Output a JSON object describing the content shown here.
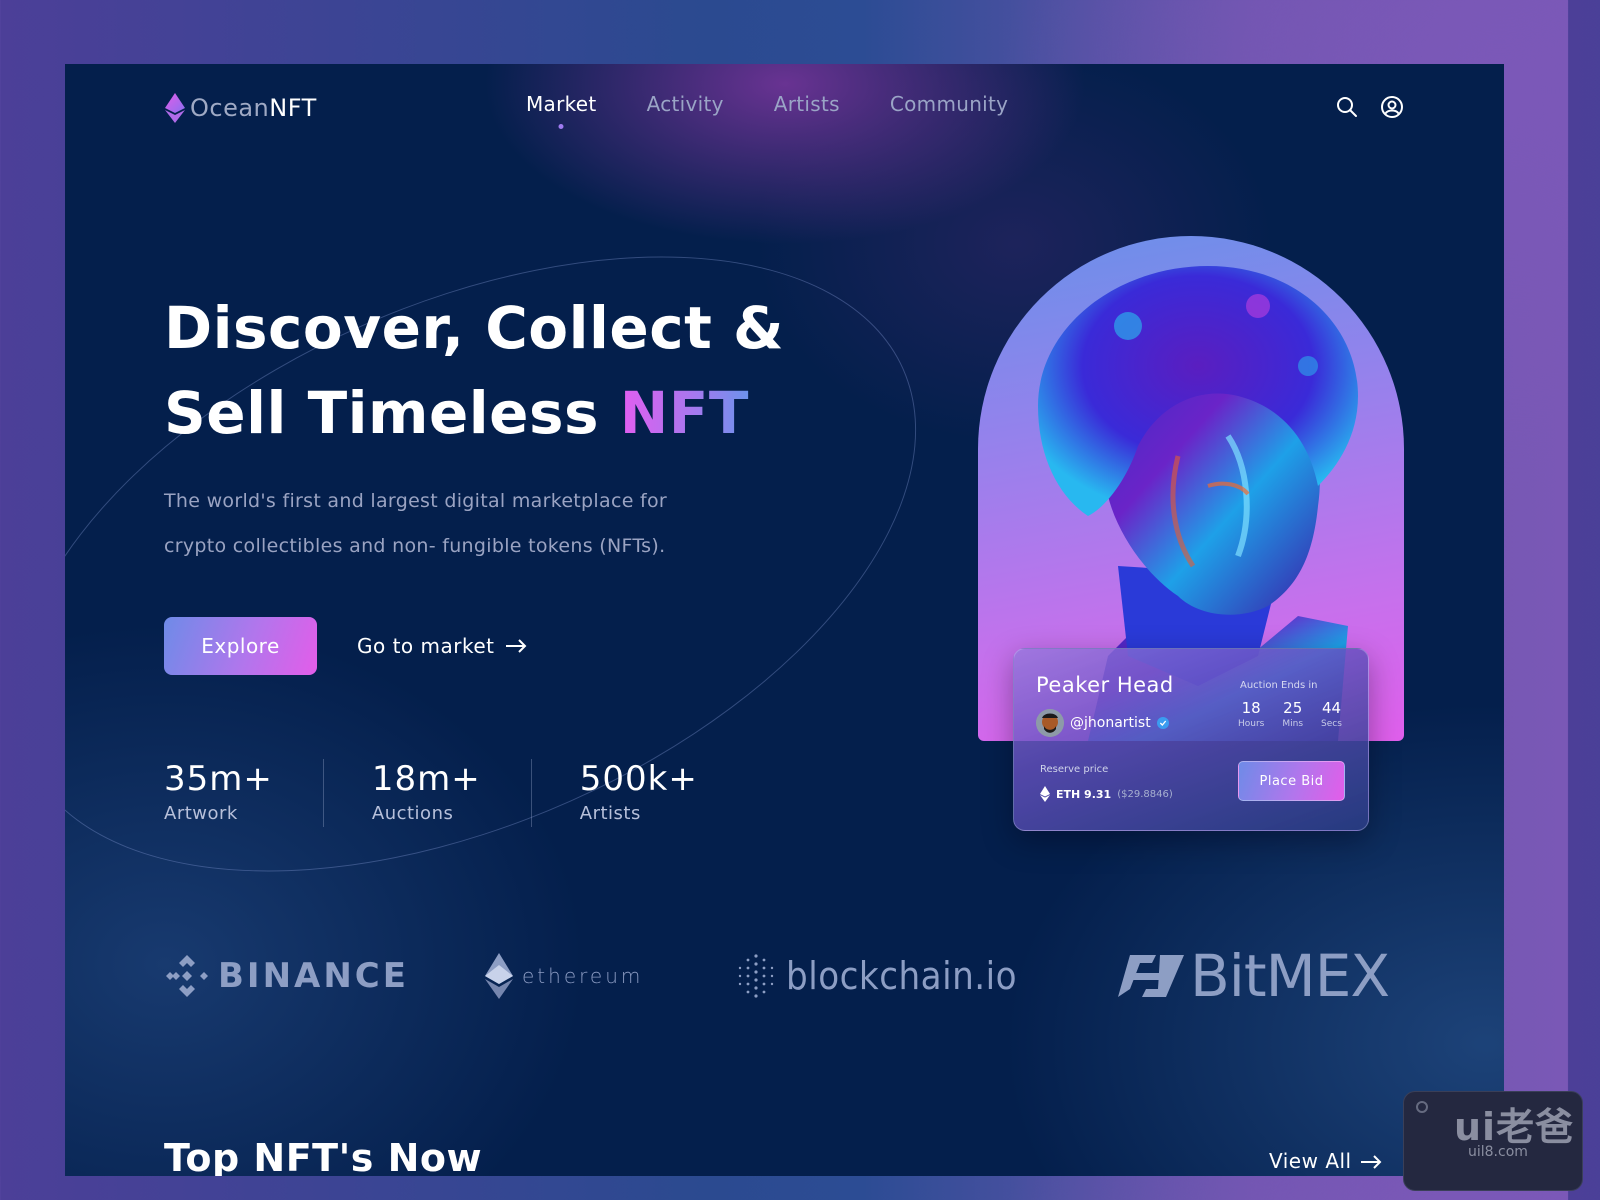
{
  "header": {
    "logo": {
      "prefix": "Ocean",
      "suffix": "NFT",
      "icon": "ethereum-diamond-icon"
    },
    "nav": [
      {
        "label": "Market",
        "active": true
      },
      {
        "label": "Activity",
        "active": false
      },
      {
        "label": "Artists",
        "active": false
      },
      {
        "label": "Community",
        "active": false
      }
    ],
    "icons": [
      "search-icon",
      "user-account-icon"
    ]
  },
  "hero": {
    "title_line1": "Discover, Collect &",
    "title_line2_plain": "Sell Timeless ",
    "title_line2_highlight": "NFT",
    "subtitle_line1": "The world's first and largest digital marketplace for",
    "subtitle_line2": "crypto collectibles and non- fungible tokens (NFTs).",
    "primary_button": "Explore",
    "secondary_button": "Go to market",
    "secondary_button_icon": "arrow-right-icon",
    "stats": [
      {
        "value": "35m+",
        "label": "Artwork"
      },
      {
        "value": "18m+",
        "label": "Auctions"
      },
      {
        "value": "500k+",
        "label": "Artists"
      }
    ]
  },
  "featured_nft": {
    "title": "Peaker Head",
    "artist": "@jhonartist",
    "artist_verified": true,
    "auction_label": "Auction Ends in",
    "countdown": [
      {
        "value": "18",
        "unit": "Hours"
      },
      {
        "value": "25",
        "unit": "Mins"
      },
      {
        "value": "44",
        "unit": "Secs"
      }
    ],
    "reserve_label": "Reserve price",
    "reserve_eth": "ETH 9.31",
    "reserve_usd": "($29.8846)",
    "bid_button": "Place Bid"
  },
  "partners": [
    {
      "name": "BINANCE",
      "icon": "binance-logo-icon"
    },
    {
      "name": "ethereum",
      "icon": "ethereum-logo-icon"
    },
    {
      "name": "blockchain.io",
      "icon": "blockchain-dots-icon"
    },
    {
      "name": "BitMEX",
      "icon": "bitmex-logo-icon"
    }
  ],
  "top_section": {
    "title": "Top NFT's Now",
    "view_all": "View All",
    "view_all_icon": "arrow-right-icon"
  },
  "watermark": {
    "text": "ui老爸",
    "sub": "uil8.com"
  },
  "colors": {
    "background": "#041f4c",
    "accent_start": "#6e8be8",
    "accent_end": "#e35de9",
    "nav_dot": "#9f7bf0",
    "muted_text": "#9aa3c2"
  }
}
